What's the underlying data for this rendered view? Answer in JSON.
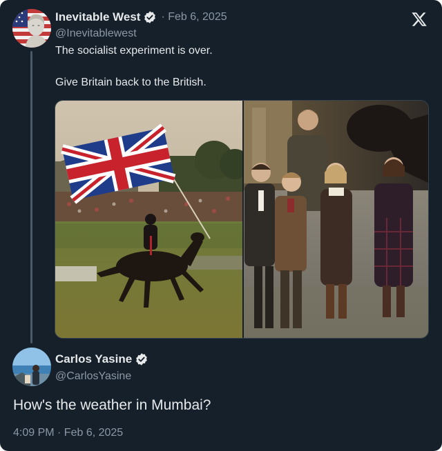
{
  "original_tweet": {
    "display_name": "Inevitable West",
    "handle": "@Inevitablewest",
    "date_text": "· Feb 6, 2025",
    "verified_icon": "verified-badge-icon",
    "text_line_1": "The socialist experiment is over.",
    "text_line_2": "Give Britain back to the British.",
    "media": [
      "horse-rider-with-union-jack-photo",
      "family-with-horse-photo"
    ]
  },
  "reply": {
    "display_name": "Carlos Yasine",
    "handle": "@CarlosYasine",
    "verified_icon": "verified-badge-icon",
    "text": "How's the weather in Mumbai?",
    "timestamp": "4:09 PM · Feb 6, 2025"
  },
  "branding": {
    "logo_icon": "x-logo-icon"
  },
  "colors": {
    "background": "#15202b",
    "primary_text": "#e7e9ea",
    "secondary_text": "#8b98a5",
    "verified": "#1d9bf0",
    "thread_line": "#4a5a66"
  }
}
